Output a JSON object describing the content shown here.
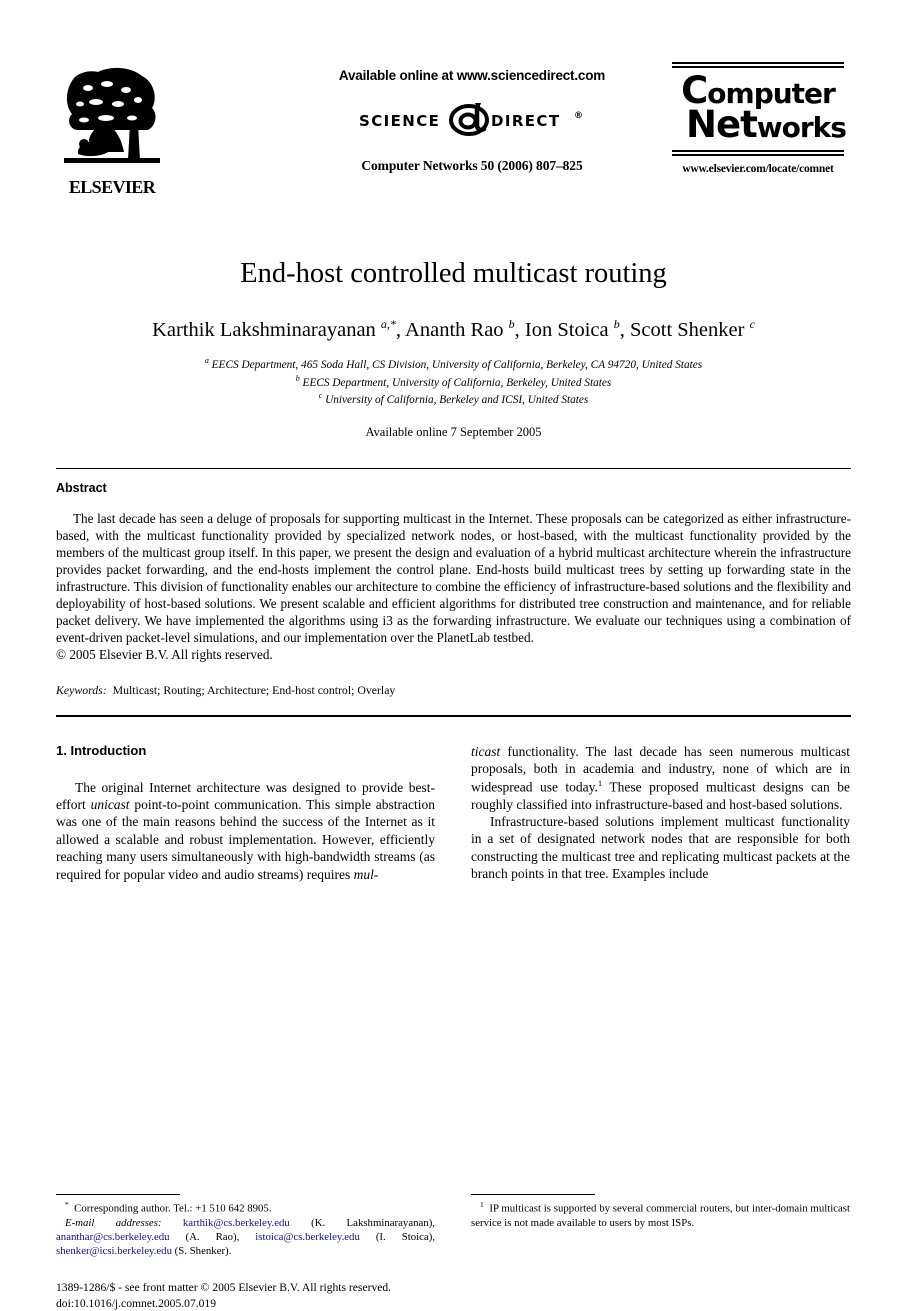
{
  "masthead": {
    "available_online": "Available online at www.sciencedirect.com",
    "sciencedirect_logo": {
      "left_word": "SCIENCE",
      "at_symbol": "@",
      "right_word": "DIRECT",
      "registered": "®"
    },
    "journal_reference": "Computer Networks 50 (2006) 807–825",
    "publisher_logo_text": "ELSEVIER",
    "journal_logo": {
      "line1_cap": "C",
      "line1_rest": "omputer",
      "line2_cap": "N",
      "line2_mid": "et",
      "line2_rest": "works"
    },
    "journal_url": "www.elsevier.com/locate/comnet"
  },
  "article": {
    "title": "End-host controlled multicast routing",
    "authors_html": "Karthik Lakshminarayanan <sup>a,*</sup>, Ananth Rao <sup>b</sup>, Ion Stoica <sup>b</sup>, Scott Shenker <sup>c</sup>",
    "affiliations": [
      {
        "marker": "a",
        "text": "EECS Department, 465 Soda Hall, CS Division, University of California, Berkeley, CA 94720, United States"
      },
      {
        "marker": "b",
        "text": "EECS Department, University of California, Berkeley, United States"
      },
      {
        "marker": "c",
        "text": "University of California, Berkeley and ICSI, United States"
      }
    ],
    "available_online_date": "Available online 7 September 2005"
  },
  "abstract": {
    "heading": "Abstract",
    "body": "The last decade has seen a deluge of proposals for supporting multicast in the Internet. These proposals can be categorized as either infrastructure-based, with the multicast functionality provided by specialized network nodes, or host-based, with the multicast functionality provided by the members of the multicast group itself. In this paper, we present the design and evaluation of a hybrid multicast architecture wherein the infrastructure provides packet forwarding, and the end-hosts implement the control plane. End-hosts build multicast trees by setting up forwarding state in the infrastructure. This division of functionality enables our architecture to combine the efficiency of infrastructure-based solutions and the flexibility and deployability of host-based solutions. We present scalable and efficient algorithms for distributed tree construction and maintenance, and for reliable packet delivery. We have implemented the algorithms using i3 as the forwarding infrastructure. We evaluate our techniques using a combination of event-driven packet-level simulations, and our implementation over the PlanetLab testbed.",
    "copyright": "© 2005 Elsevier B.V. All rights reserved.",
    "keywords_label": "Keywords:",
    "keywords_value": "Multicast; Routing; Architecture; End-host control; Overlay"
  },
  "body": {
    "section_heading": "1. Introduction",
    "left_column_paragraph_1_html": "The original Internet architecture was designed to provide best-effort <i>unicast</i> point-to-point communication. This simple abstraction was one of the main reasons behind the success of the Internet as it allowed a scalable and robust implementation. However, efficiently reaching many users simultaneously with high-bandwidth streams (as required for popular video and audio streams) requires <i>mul-</i>",
    "right_column_paragraph_1_html": "<i>ticast</i> functionality. The last decade has seen numerous multicast proposals, both in academia and industry, none of which are in widespread use today.<sup>1</sup> These proposed multicast designs can be roughly classified into infrastructure-based and host-based solutions.",
    "right_column_paragraph_2_html": "Infrastructure-based solutions implement multicast functionality in a set of designated network nodes that are responsible for both constructing the multicast tree and replicating multicast packets at the branch points in that tree. Examples include"
  },
  "footnotes": {
    "left_html": "<sup>*</sup>&nbsp; Corresponding author. Tel.: +1 510 642 8905.",
    "emails_html": "<i>E-mail addresses:</i> <span class=\"maillink\">karthik@cs.berkeley.edu</span> (K. Lakshminarayanan), <span class=\"maillink\">ananthar@cs.berkeley.edu</span> (A. Rao), <span class=\"maillink\">istoica@cs.berkeley.edu</span> (I. Stoica), <span class=\"maillink\">shenker@icsi.berkeley.edu</span> (S. Shenker).",
    "right_html": "<sup>1</sup>&nbsp; IP multicast is supported by several commercial routers, but inter-domain multicast service is not made available to users by most ISPs.",
    "issn_line": "1389-1286/$ - see front matter © 2005 Elsevier B.V. All rights reserved.",
    "doi_line": "doi:10.1016/j.comnet.2005.07.019"
  },
  "colors": {
    "link": "#10108c",
    "text": "#000000",
    "background": "#ffffff"
  }
}
